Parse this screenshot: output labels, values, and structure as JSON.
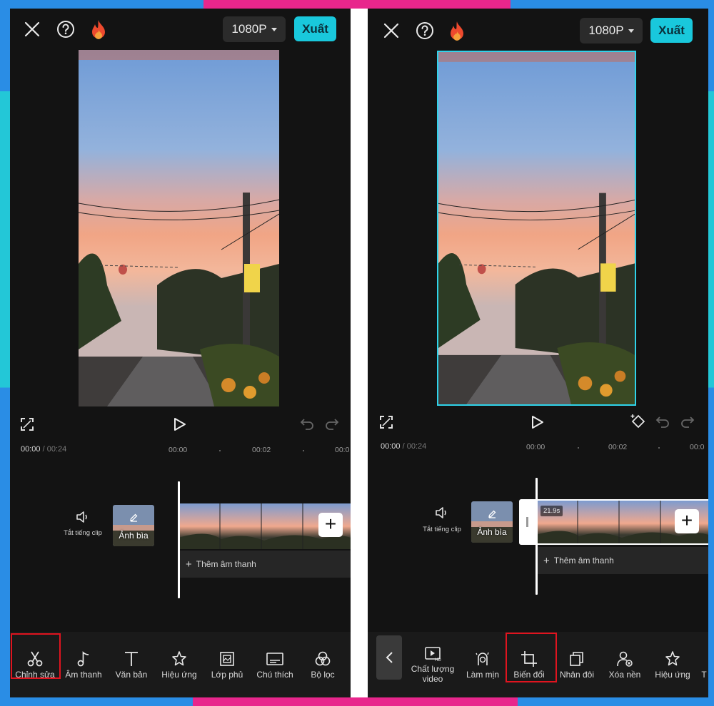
{
  "colors": {
    "frame_pink": "#e8268c",
    "frame_blue": "#2a8de5",
    "frame_cyan": "#23c7d7",
    "export_bg": "#19c8dc",
    "highlight": "#e0141f",
    "selection": "#2fd3ea"
  },
  "left_screen": {
    "topbar": {
      "close_icon": "close-icon",
      "help_icon": "help-icon",
      "flame_icon": "flame-icon",
      "resolution": "1080P",
      "export_label": "Xuất"
    },
    "controls": {
      "fullscreen_icon": "fullscreen-icon",
      "play_icon": "play-icon",
      "undo_icon": "undo-icon",
      "redo_icon": "redo-icon"
    },
    "time": {
      "current": "00:00",
      "separator": "/",
      "total": "00:24"
    },
    "ruler": [
      "00:00",
      "00:02",
      "00:0"
    ],
    "timeline": {
      "mute_label": "Tắt tiếng clip",
      "cover_label": "Ảnh bìa",
      "add_audio_label": "Thêm âm thanh",
      "add_audio_plus": "+",
      "add_clip_plus": "+"
    },
    "toolbar": [
      {
        "label": "Chỉnh sửa",
        "icon": "scissors-icon"
      },
      {
        "label": "Âm thanh",
        "icon": "music-note-icon"
      },
      {
        "label": "Văn bản",
        "icon": "text-icon"
      },
      {
        "label": "Hiệu ứng",
        "icon": "sparkle-star-icon"
      },
      {
        "label": "Lớp phủ",
        "icon": "overlay-icon"
      },
      {
        "label": "Chú thích",
        "icon": "caption-icon"
      },
      {
        "label": "Bộ lọc",
        "icon": "filter-icon"
      }
    ]
  },
  "right_screen": {
    "topbar": {
      "close_icon": "close-icon",
      "help_icon": "help-icon",
      "flame_icon": "flame-icon",
      "resolution": "1080P",
      "export_label": "Xuất"
    },
    "controls": {
      "fullscreen_icon": "fullscreen-icon",
      "play_icon": "play-icon",
      "keyframe_icon": "keyframe-icon",
      "undo_icon": "undo-icon",
      "redo_icon": "redo-icon"
    },
    "time": {
      "current": "00:00",
      "separator": "/",
      "total": "00:24"
    },
    "ruler": [
      "00:00",
      "00:02",
      "00:0"
    ],
    "timeline": {
      "mute_label": "Tắt tiếng clip",
      "cover_label": "Ảnh bìa",
      "clip_duration": "21.9s",
      "add_audio_label": "Thêm âm thanh",
      "add_audio_plus": "+",
      "add_clip_plus": "+"
    },
    "toolbar": [
      {
        "label": "Chất lượng\nvideo",
        "icon": "video-hd-icon"
      },
      {
        "label": "Làm mịn",
        "icon": "smooth-face-icon"
      },
      {
        "label": "Biến đổi",
        "icon": "crop-icon"
      },
      {
        "label": "Nhân đôi",
        "icon": "duplicate-icon"
      },
      {
        "label": "Xóa nền",
        "icon": "remove-bg-icon"
      },
      {
        "label": "Hiệu ứng",
        "icon": "sparkle-star-icon"
      },
      {
        "label": "T",
        "icon": ""
      }
    ]
  }
}
